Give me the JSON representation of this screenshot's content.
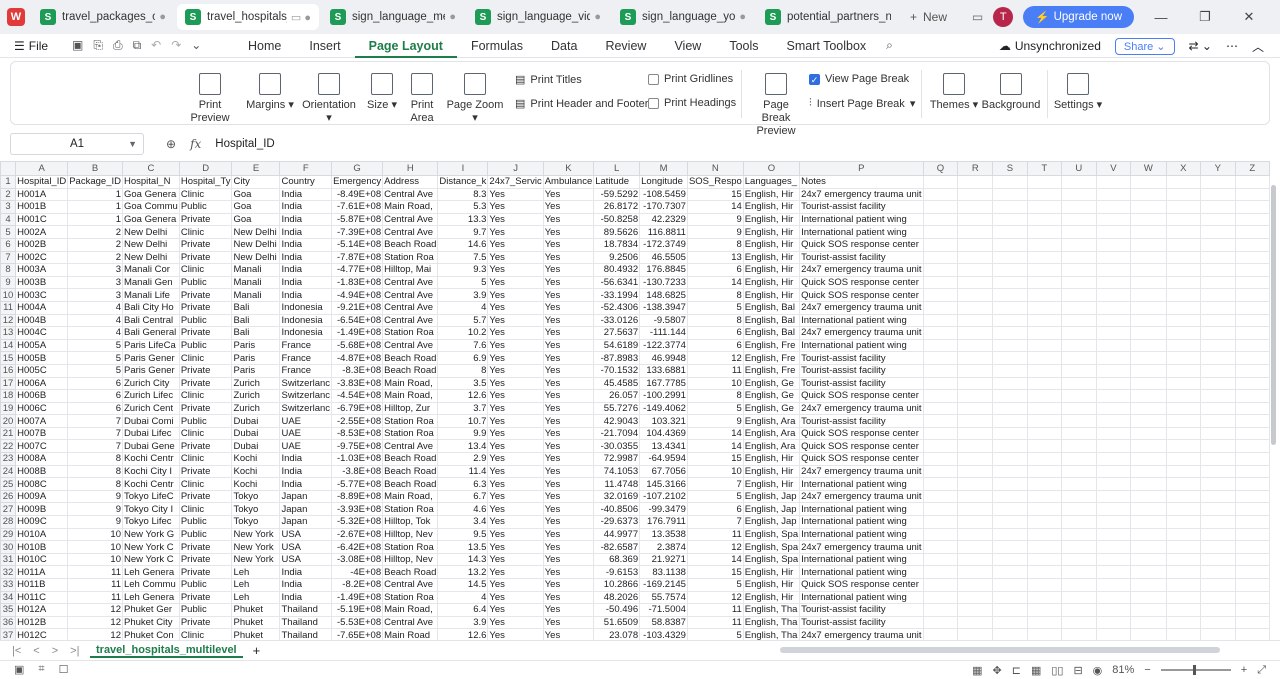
{
  "tabs": [
    {
      "label": "travel_packages_csv.csv",
      "active": false,
      "close": true
    },
    {
      "label": "travel_hospitals_r",
      "active": true,
      "close": false
    },
    {
      "label": "sign_language_medi",
      "active": false,
      "close": true
    },
    {
      "label": "sign_language_video",
      "active": false,
      "close": true
    },
    {
      "label": "sign_language_youtu",
      "active": false,
      "close": true
    },
    {
      "label": "potential_partners_ngos",
      "active": false,
      "close": false
    }
  ],
  "new_tab_label": "New",
  "avatar_letter": "T",
  "upgrade_label": "Upgrade now",
  "file_label": "File",
  "menus": [
    "Home",
    "Insert",
    "Page Layout",
    "Formulas",
    "Data",
    "Review",
    "View",
    "Tools",
    "Smart Toolbox"
  ],
  "active_menu": "Page Layout",
  "sync_label": "Unsynchronized",
  "share_label": "Share",
  "ribbon": {
    "print_preview": "Print Preview",
    "margins": "Margins",
    "orientation": "Orientation",
    "size": "Size",
    "print_area": "Print Area",
    "page_zoom": "Page Zoom",
    "print_titles": "Print Titles",
    "print_header_footer": "Print Header and Footer",
    "print_gridlines": "Print Gridlines",
    "print_headings": "Print Headings",
    "page_break_preview": "Page Break Preview",
    "view_page_break": "View Page Break",
    "insert_page_break": "Insert Page Break",
    "themes": "Themes",
    "background": "Background",
    "settings": "Settings"
  },
  "name_box": "A1",
  "formula": "Hospital_ID",
  "columns": [
    "A",
    "B",
    "C",
    "D",
    "E",
    "F",
    "G",
    "H",
    "I",
    "J",
    "K",
    "L",
    "M",
    "N",
    "O",
    "P",
    "Q",
    "R",
    "S",
    "T",
    "U",
    "V",
    "W",
    "X",
    "Y",
    "Z"
  ],
  "rows": [
    [
      "Hospital_ID",
      "Package_ID",
      "Hospital_N",
      "Hospital_Ty",
      "City",
      "Country",
      "Emergency",
      "Address",
      "Distance_k",
      "24x7_Servic",
      "Ambulance",
      "Latitude",
      "Longitude",
      "SOS_Respo",
      "Languages_",
      "Notes"
    ],
    [
      "H001A",
      "1",
      "Goa Genera",
      "Clinic",
      "Goa",
      "India",
      "-8.49E+08",
      "Central Ave",
      "8.3",
      "Yes",
      "Yes",
      "-59.5292",
      "-108.5459",
      "15",
      "English, Hir",
      "24x7 emergency trauma unit"
    ],
    [
      "H001B",
      "1",
      "Goa Commu",
      "Public",
      "Goa",
      "India",
      "-7.61E+08",
      "Main Road,",
      "5.3",
      "Yes",
      "Yes",
      "26.8172",
      "-170.7307",
      "14",
      "English, Hir",
      "Tourist-assist facility"
    ],
    [
      "H001C",
      "1",
      "Goa Genera",
      "Private",
      "Goa",
      "India",
      "-5.87E+08",
      "Central Ave",
      "13.3",
      "Yes",
      "Yes",
      "-50.8258",
      "42.2329",
      "9",
      "English, Hir",
      "International patient wing"
    ],
    [
      "H002A",
      "2",
      "New Delhi",
      "Clinic",
      "New Delhi",
      "India",
      "-7.39E+08",
      "Central Ave",
      "9.7",
      "Yes",
      "Yes",
      "89.5626",
      "116.8811",
      "9",
      "English, Hir",
      "International patient wing"
    ],
    [
      "H002B",
      "2",
      "New Delhi",
      "Private",
      "New Delhi",
      "India",
      "-5.14E+08",
      "Beach Road",
      "14.6",
      "Yes",
      "Yes",
      "18.7834",
      "-172.3749",
      "8",
      "English, Hir",
      "Quick SOS response center"
    ],
    [
      "H002C",
      "2",
      "New Delhi",
      "Private",
      "New Delhi",
      "India",
      "-7.87E+08",
      "Station Roa",
      "7.5",
      "Yes",
      "Yes",
      "9.2506",
      "46.5505",
      "13",
      "English, Hir",
      "Tourist-assist facility"
    ],
    [
      "H003A",
      "3",
      "Manali Cor",
      "Clinic",
      "Manali",
      "India",
      "-4.77E+08",
      "Hilltop, Mai",
      "9.3",
      "Yes",
      "Yes",
      "80.4932",
      "176.8845",
      "6",
      "English, Hir",
      "24x7 emergency trauma unit"
    ],
    [
      "H003B",
      "3",
      "Manali Gen",
      "Public",
      "Manali",
      "India",
      "-1.83E+08",
      "Central Ave",
      "5",
      "Yes",
      "Yes",
      "-56.6341",
      "-130.7233",
      "14",
      "English, Hir",
      "Quick SOS response center"
    ],
    [
      "H003C",
      "3",
      "Manali Life",
      "Private",
      "Manali",
      "India",
      "-4.94E+08",
      "Central Ave",
      "3.9",
      "Yes",
      "Yes",
      "-33.1994",
      "148.6825",
      "8",
      "English, Hir",
      "Quick SOS response center"
    ],
    [
      "H004A",
      "4",
      "Bali City Ho",
      "Private",
      "Bali",
      "Indonesia",
      "-9.21E+08",
      "Central Ave",
      "4",
      "Yes",
      "Yes",
      "-52.4306",
      "-138.3947",
      "5",
      "English, Bal",
      "24x7 emergency trauma unit"
    ],
    [
      "H004B",
      "4",
      "Bali Central",
      "Public",
      "Bali",
      "Indonesia",
      "-6.54E+08",
      "Central Ave",
      "5.7",
      "Yes",
      "Yes",
      "-33.0126",
      "-9.5807",
      "8",
      "English, Bal",
      "International patient wing"
    ],
    [
      "H004C",
      "4",
      "Bali General",
      "Private",
      "Bali",
      "Indonesia",
      "-1.49E+08",
      "Station Roa",
      "10.2",
      "Yes",
      "Yes",
      "27.5637",
      "-111.144",
      "6",
      "English, Bal",
      "24x7 emergency trauma unit"
    ],
    [
      "H005A",
      "5",
      "Paris LifeCa",
      "Public",
      "Paris",
      "France",
      "-5.68E+08",
      "Central Ave",
      "7.6",
      "Yes",
      "Yes",
      "54.6189",
      "-122.3774",
      "6",
      "English, Fre",
      "International patient wing"
    ],
    [
      "H005B",
      "5",
      "Paris Gener",
      "Clinic",
      "Paris",
      "France",
      "-4.87E+08",
      "Beach Road",
      "6.9",
      "Yes",
      "Yes",
      "-87.8983",
      "46.9948",
      "12",
      "English, Fre",
      "Tourist-assist facility"
    ],
    [
      "H005C",
      "5",
      "Paris Gener",
      "Private",
      "Paris",
      "France",
      "-8.3E+08",
      "Beach Road",
      "8",
      "Yes",
      "Yes",
      "-70.1532",
      "133.6881",
      "11",
      "English, Fre",
      "Tourist-assist facility"
    ],
    [
      "H006A",
      "6",
      "Zurich City",
      "Private",
      "Zurich",
      "Switzerlanc",
      "-3.83E+08",
      "Main Road,",
      "3.5",
      "Yes",
      "Yes",
      "45.4585",
      "167.7785",
      "10",
      "English, Ge",
      "Tourist-assist facility"
    ],
    [
      "H006B",
      "6",
      "Zurich Lifec",
      "Clinic",
      "Zurich",
      "Switzerlanc",
      "-4.54E+08",
      "Main Road,",
      "12.6",
      "Yes",
      "Yes",
      "26.057",
      "-100.2991",
      "8",
      "English, Ge",
      "Quick SOS response center"
    ],
    [
      "H006C",
      "6",
      "Zurich Cent",
      "Private",
      "Zurich",
      "Switzerlanc",
      "-6.79E+08",
      "Hilltop, Zur",
      "3.7",
      "Yes",
      "Yes",
      "55.7276",
      "-149.4062",
      "5",
      "English, Ge",
      "24x7 emergency trauma unit"
    ],
    [
      "H007A",
      "7",
      "Dubai Comi",
      "Public",
      "Dubai",
      "UAE",
      "-2.55E+08",
      "Station Roa",
      "10.7",
      "Yes",
      "Yes",
      "42.9043",
      "103.321",
      "9",
      "English, Ara",
      "Tourist-assist facility"
    ],
    [
      "H007B",
      "7",
      "Dubai Lifec",
      "Clinic",
      "Dubai",
      "UAE",
      "-8.53E+08",
      "Station Roa",
      "9.9",
      "Yes",
      "Yes",
      "-21.7094",
      "104.4369",
      "14",
      "English, Ara",
      "Quick SOS response center"
    ],
    [
      "H007C",
      "7",
      "Dubai Gene",
      "Private",
      "Dubai",
      "UAE",
      "-9.75E+08",
      "Central Ave",
      "13.4",
      "Yes",
      "Yes",
      "-30.0355",
      "13.4341",
      "14",
      "English, Ara",
      "Quick SOS response center"
    ],
    [
      "H008A",
      "8",
      "Kochi Centr",
      "Clinic",
      "Kochi",
      "India",
      "-1.03E+08",
      "Beach Road",
      "2.9",
      "Yes",
      "Yes",
      "72.9987",
      "-64.9594",
      "15",
      "English, Hir",
      "Quick SOS response center"
    ],
    [
      "H008B",
      "8",
      "Kochi City I",
      "Private",
      "Kochi",
      "India",
      "-3.8E+08",
      "Beach Road",
      "11.4",
      "Yes",
      "Yes",
      "74.1053",
      "67.7056",
      "10",
      "English, Hir",
      "24x7 emergency trauma unit"
    ],
    [
      "H008C",
      "8",
      "Kochi Centr",
      "Clinic",
      "Kochi",
      "India",
      "-5.77E+08",
      "Beach Road",
      "6.3",
      "Yes",
      "Yes",
      "11.4748",
      "145.3166",
      "7",
      "English, Hir",
      "International patient wing"
    ],
    [
      "H009A",
      "9",
      "Tokyo LifeC",
      "Private",
      "Tokyo",
      "Japan",
      "-8.89E+08",
      "Main Road,",
      "6.7",
      "Yes",
      "Yes",
      "32.0169",
      "-107.2102",
      "5",
      "English, Jap",
      "24x7 emergency trauma unit"
    ],
    [
      "H009B",
      "9",
      "Tokyo City I",
      "Clinic",
      "Tokyo",
      "Japan",
      "-3.93E+08",
      "Station Roa",
      "4.6",
      "Yes",
      "Yes",
      "-40.8506",
      "-99.3479",
      "6",
      "English, Jap",
      "International patient wing"
    ],
    [
      "H009C",
      "9",
      "Tokyo Lifec",
      "Public",
      "Tokyo",
      "Japan",
      "-5.32E+08",
      "Hilltop, Tok",
      "3.4",
      "Yes",
      "Yes",
      "-29.6373",
      "176.7911",
      "7",
      "English, Jap",
      "International patient wing"
    ],
    [
      "H010A",
      "10",
      "New York G",
      "Public",
      "New York",
      "USA",
      "-2.67E+08",
      "Hilltop, Nev",
      "9.5",
      "Yes",
      "Yes",
      "44.9977",
      "13.3538",
      "11",
      "English, Spa",
      "International patient wing"
    ],
    [
      "H010B",
      "10",
      "New York C",
      "Private",
      "New York",
      "USA",
      "-6.42E+08",
      "Station Roa",
      "13.5",
      "Yes",
      "Yes",
      "-82.6587",
      "2.3874",
      "12",
      "English, Spa",
      "24x7 emergency trauma unit"
    ],
    [
      "H010C",
      "10",
      "New York C",
      "Private",
      "New York",
      "USA",
      "-3.08E+08",
      "Hilltop, Nev",
      "14.3",
      "Yes",
      "Yes",
      "68.369",
      "21.9271",
      "14",
      "English, Spa",
      "International patient wing"
    ],
    [
      "H011A",
      "11",
      "Leh Genera",
      "Private",
      "Leh",
      "India",
      "-4E+08",
      "Beach Road",
      "13.2",
      "Yes",
      "Yes",
      "-9.6153",
      "83.1138",
      "15",
      "English, Hir",
      "International patient wing"
    ],
    [
      "H011B",
      "11",
      "Leh Commu",
      "Public",
      "Leh",
      "India",
      "-8.2E+08",
      "Central Ave",
      "14.5",
      "Yes",
      "Yes",
      "10.2866",
      "-169.2145",
      "5",
      "English, Hir",
      "Quick SOS response center"
    ],
    [
      "H011C",
      "11",
      "Leh Genera",
      "Private",
      "Leh",
      "India",
      "-1.49E+08",
      "Station Roa",
      "4",
      "Yes",
      "Yes",
      "48.2026",
      "55.7574",
      "12",
      "English, Hir",
      "International patient wing"
    ],
    [
      "H012A",
      "12",
      "Phuket Ger",
      "Public",
      "Phuket",
      "Thailand",
      "-5.19E+08",
      "Main Road,",
      "6.4",
      "Yes",
      "Yes",
      "-50.496",
      "-71.5004",
      "11",
      "English, Tha",
      "Tourist-assist facility"
    ],
    [
      "H012B",
      "12",
      "Phuket City",
      "Private",
      "Phuket",
      "Thailand",
      "-5.53E+08",
      "Central Ave",
      "3.9",
      "Yes",
      "Yes",
      "51.6509",
      "58.8387",
      "11",
      "English, Tha",
      "Tourist-assist facility"
    ],
    [
      "H012C",
      "12",
      "Phuket Con",
      "Clinic",
      "Phuket",
      "Thailand",
      "-7.65E+08",
      "Main Road",
      "12.6",
      "Yes",
      "Yes",
      "23.078",
      "-103.4329",
      "5",
      "English, Tha",
      "24x7 emergency trauma unit"
    ]
  ],
  "sheet_tab": "travel_hospitals_multilevel",
  "zoom_level": "81%"
}
